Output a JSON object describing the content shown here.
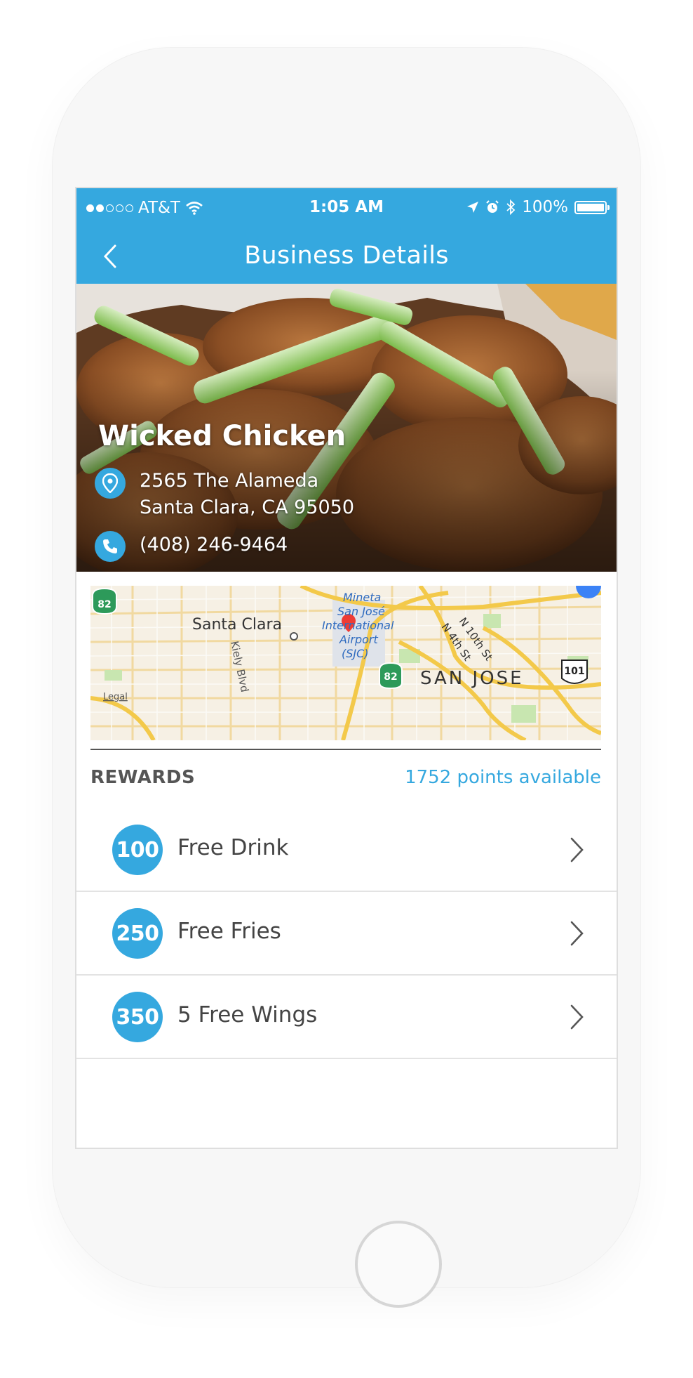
{
  "status_bar": {
    "carrier": "AT&T",
    "time": "1:05 AM",
    "battery": "100%",
    "icons": [
      "wifi-icon",
      "location-arrow-icon",
      "alarm-icon",
      "bluetooth-icon",
      "battery-icon"
    ]
  },
  "nav": {
    "title": "Business Details",
    "back_icon": "chevron-left-icon"
  },
  "business": {
    "name": "Wicked Chicken",
    "address_line1": "2565 The Alameda",
    "address_line2": "Santa Clara, CA 95050",
    "phone": "(408) 246-9464"
  },
  "map": {
    "labels": {
      "santa_clara": "Santa Clara",
      "kiely": "Kiely Blvd",
      "airport1": "Mineta",
      "airport2": "San José",
      "airport3": "International",
      "airport4": "Airport",
      "airport5": "(SJC)",
      "n10th": "N 10th St",
      "n4th": "N 4th St",
      "san_jose": "SAN JOSE",
      "legal": "Legal"
    },
    "shields": [
      "82",
      "82",
      "101"
    ]
  },
  "rewards": {
    "label": "REWARDS",
    "points_available": "1752 points available",
    "items": [
      {
        "points": "100",
        "name": "Free Drink"
      },
      {
        "points": "250",
        "name": "Free Fries"
      },
      {
        "points": "350",
        "name": "5 Free Wings"
      }
    ]
  },
  "colors": {
    "accent": "#35a8df",
    "text_dark": "#444444",
    "divider": "#e3e3e3"
  }
}
